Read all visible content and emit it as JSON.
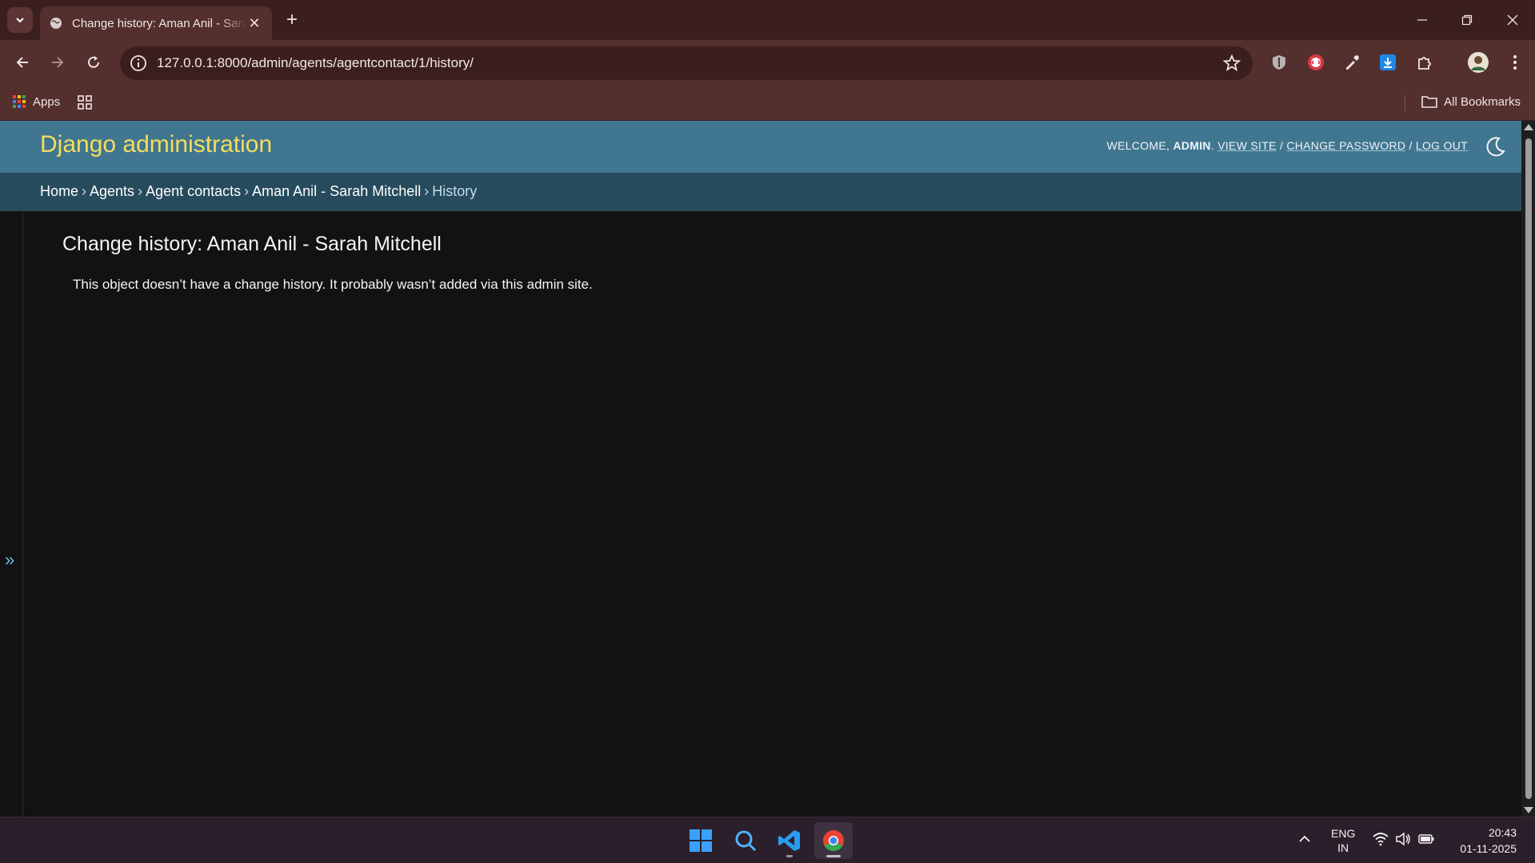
{
  "browser": {
    "tab_title": "Change history: Aman Anil - Sarah Mitchell",
    "url": "127.0.0.1:8000/admin/agents/agentcontact/1/history/",
    "bookmarks": {
      "apps_label": "Apps",
      "all_bookmarks_label": "All Bookmarks"
    }
  },
  "header": {
    "branding": "Django administration",
    "welcome": "WELCOME,",
    "username": "ADMIN",
    "view_site": "VIEW SITE",
    "change_password": "CHANGE PASSWORD",
    "log_out": "LOG OUT",
    "separator": "/"
  },
  "breadcrumbs": [
    "Home",
    "Agents",
    "Agent contacts",
    "Aman Anil - Sarah Mitchell",
    "History"
  ],
  "content": {
    "title": "Change history: Aman Anil - Sarah Mitchell",
    "message": "This object doesn’t have a change history. It probably wasn’t added via this admin site."
  },
  "sidebar": {
    "toggle_label": "»"
  },
  "taskbar": {
    "lang_line1": "ENG",
    "lang_line2": "IN",
    "time": "20:43",
    "date": "01-11-2025"
  },
  "colors": {
    "header_bg": "#417690",
    "breadcrumbs_bg": "#264b5d",
    "branding": "#f5dd5d",
    "page_bg": "#121212"
  }
}
